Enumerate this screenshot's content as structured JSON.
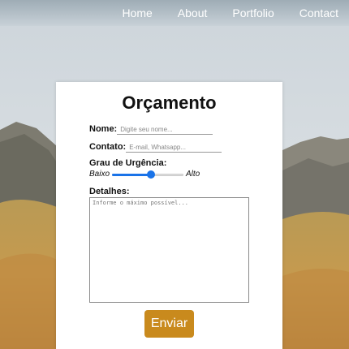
{
  "nav": {
    "links": [
      "Home",
      "About",
      "Portfolio",
      "Contact"
    ]
  },
  "form": {
    "title": "Orçamento",
    "name_label": "Nome:",
    "name_placeholder": "Digite seu nome...",
    "contact_label": "Contato:",
    "contact_placeholder": "E-mail, Whatsapp...",
    "urgency_label": "Grau de Urgência:",
    "urgency_low": "Baixo",
    "urgency_high": "Alto",
    "urgency_value_fraction": 0.55,
    "details_label": "Detalhes:",
    "details_placeholder": "Informe o máximo possível...",
    "submit_label": "Enviar"
  },
  "colors": {
    "accent": "#c98a1d",
    "slider": "#1a73e8"
  }
}
